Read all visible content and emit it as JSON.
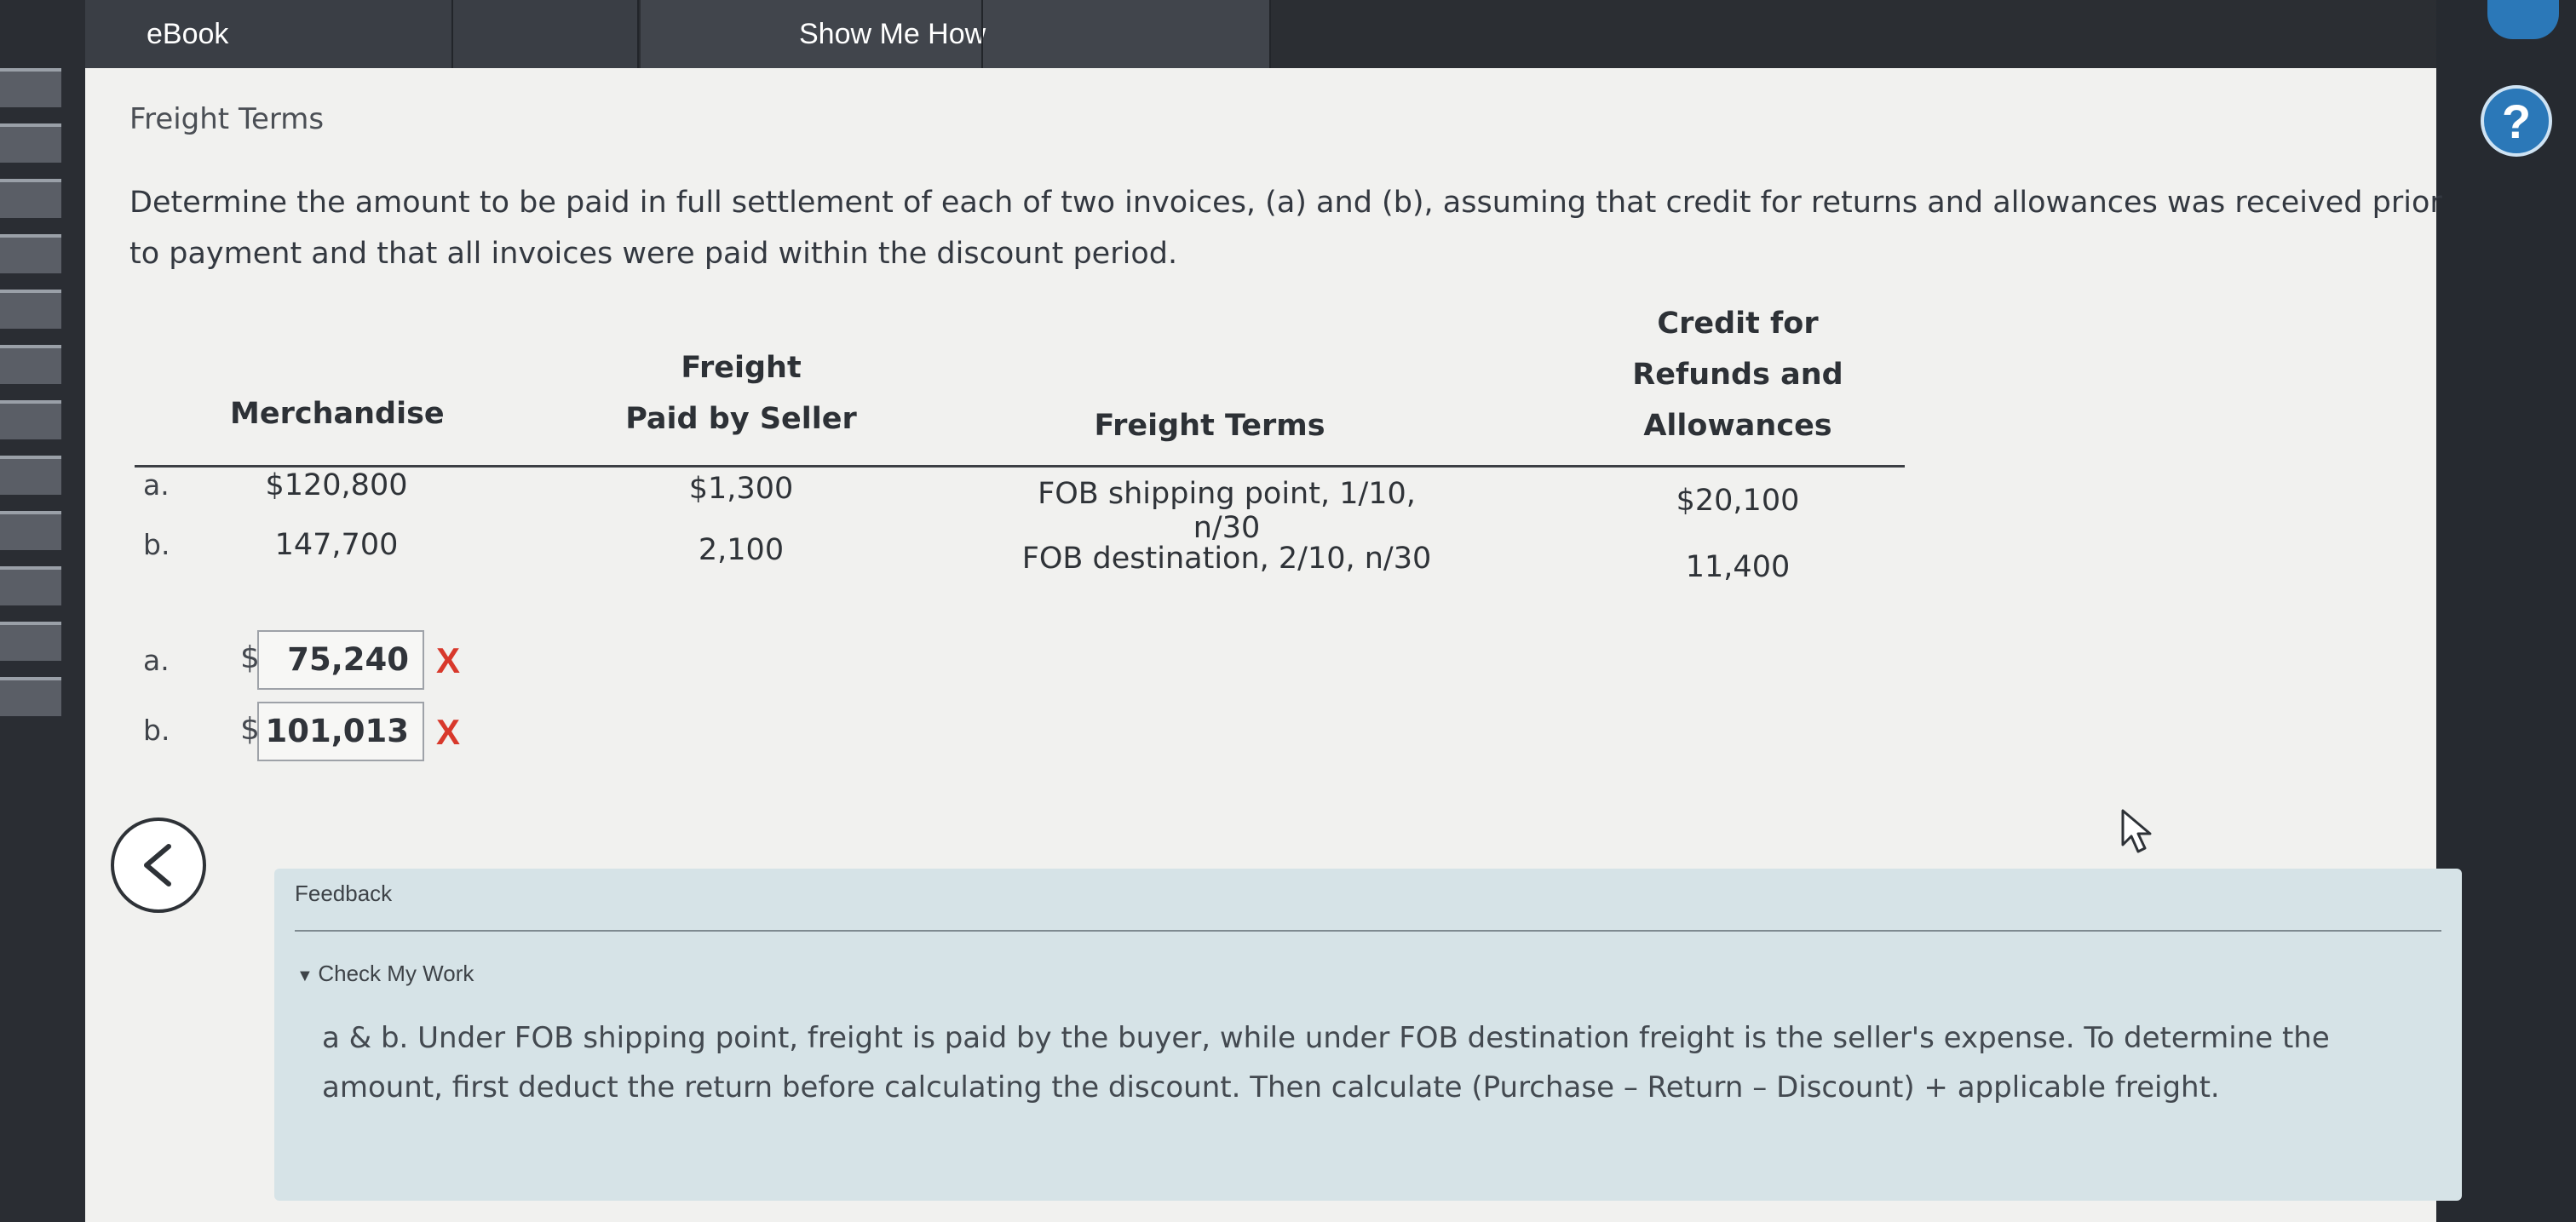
{
  "tabs": {
    "ebook": "eBook",
    "show_me_how": "Show Me How"
  },
  "help_label": "?",
  "problem": {
    "title": "Freight Terms",
    "instructions": "Determine the amount to be paid in full settlement of each of two invoices, (a) and (b), assuming that credit for returns and allowances was received prior to payment and that all invoices were paid within the discount period."
  },
  "table": {
    "headers": {
      "merchandise": "Merchandise",
      "freight_line1": "Freight",
      "freight_line2": "Paid by Seller",
      "terms": "Freight Terms",
      "credit_line1": "Credit for",
      "credit_line2": "Refunds and",
      "credit_line3": "Allowances"
    },
    "rows": [
      {
        "label": "a.",
        "merchandise": "$120,800",
        "freight": "$1,300",
        "terms": "FOB shipping point, 1/10, n/30",
        "credit": "$20,100"
      },
      {
        "label": "b.",
        "merchandise": "147,700",
        "freight": "2,100",
        "terms": "FOB destination, 2/10, n/30",
        "credit": "11,400"
      }
    ]
  },
  "answers": [
    {
      "label": "a.",
      "currency": "$",
      "value": "75,240",
      "mark": "X"
    },
    {
      "label": "b.",
      "currency": "$",
      "value": "101,013",
      "mark": "X"
    }
  ],
  "feedback": {
    "title": "Feedback",
    "section": "Check My Work",
    "text": "a & b. Under FOB shipping point, freight is paid by the buyer, while under FOB destination freight is the seller's expense. To determine the amount, first deduct the return before calculating the discount. Then calculate (Purchase – Return – Discount) + applicable freight."
  },
  "colors": {
    "accent": "#2b78b8",
    "error": "#d8382b",
    "feedback_bg": "#d6e3e7"
  }
}
